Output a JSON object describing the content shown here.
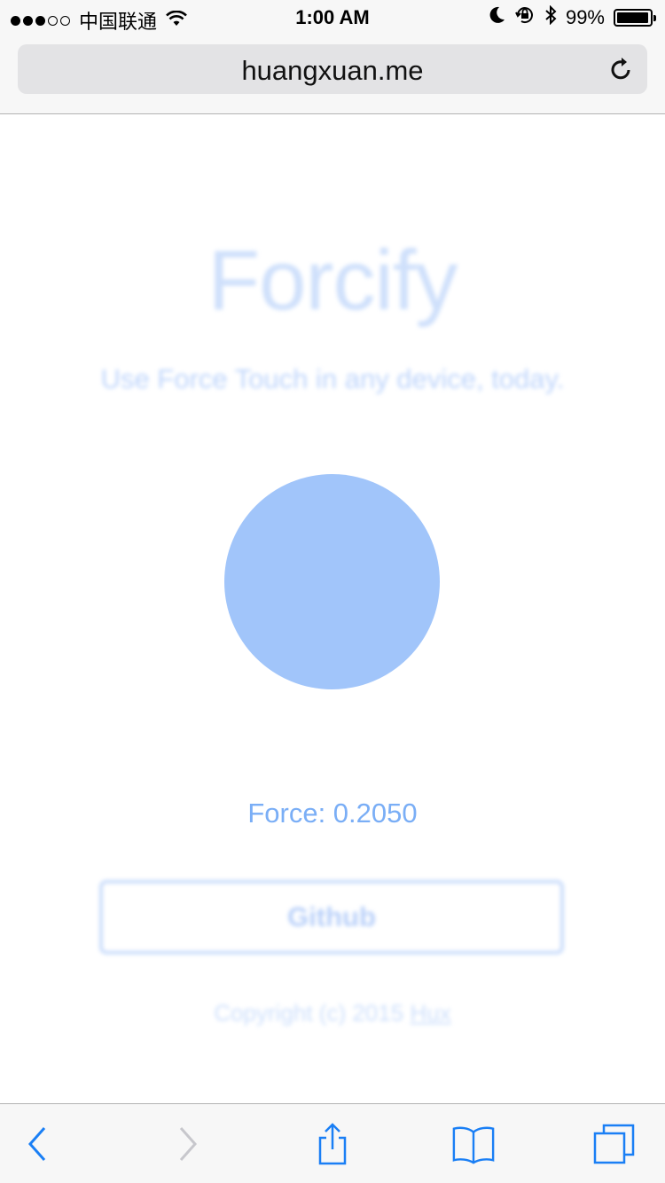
{
  "status_bar": {
    "signal_strength": 3,
    "signal_max": 5,
    "carrier": "中国联通",
    "time": "1:00 AM",
    "battery_percent": "99%",
    "icons": [
      "wifi-icon",
      "moon-icon",
      "orientation-lock-icon",
      "bluetooth-icon",
      "battery-icon"
    ]
  },
  "address_bar": {
    "url": "huangxuan.me",
    "reload_icon": "reload-icon"
  },
  "page": {
    "title": "Forcify",
    "subtitle": "Use Force Touch in any device, today.",
    "force_label": "Force: 0.2050",
    "force_value": 0.205,
    "github_label": "Github",
    "copyright_text": "Copyright (c) 2015",
    "copyright_link": "Hux",
    "colors": {
      "accent": "#a1c5fa",
      "readout": "#7aaef6",
      "toolbar_active": "#1a7ff5",
      "toolbar_disabled": "#c7c7cc"
    }
  },
  "toolbar": {
    "buttons": [
      "back-icon",
      "forward-icon",
      "share-icon",
      "bookmarks-icon",
      "tabs-icon"
    ]
  }
}
